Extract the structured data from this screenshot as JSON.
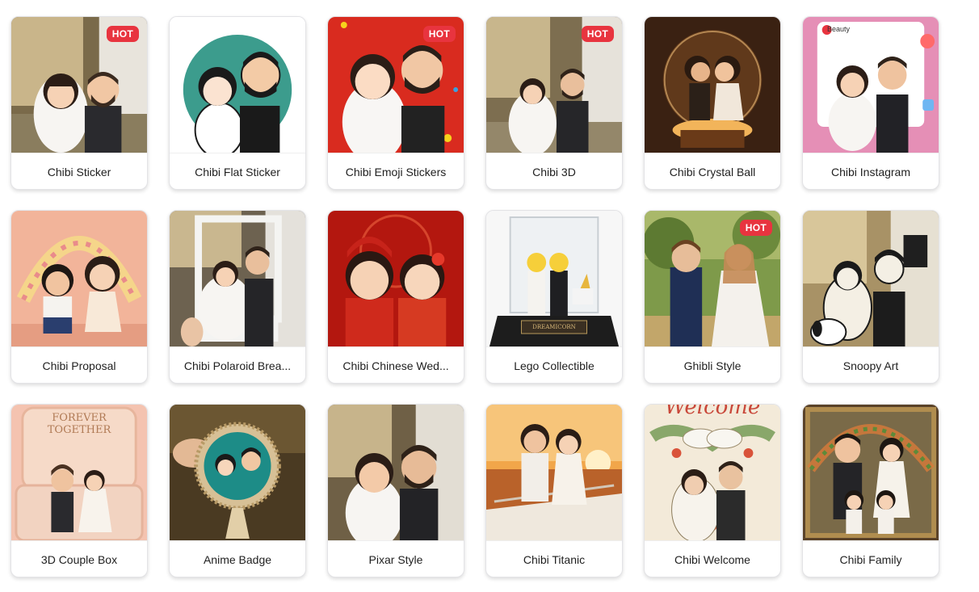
{
  "styles": [
    {
      "label": "Chibi Sticker",
      "hot": true,
      "icon": "chibi-sticker-image"
    },
    {
      "label": "Chibi Flat Sticker",
      "hot": false,
      "icon": "chibi-flat-sticker-image"
    },
    {
      "label": "Chibi Emoji Stickers",
      "hot": true,
      "icon": "chibi-emoji-stickers-image"
    },
    {
      "label": "Chibi 3D",
      "hot": true,
      "icon": "chibi-3d-image"
    },
    {
      "label": "Chibi Crystal Ball",
      "hot": false,
      "icon": "chibi-crystal-ball-image"
    },
    {
      "label": "Chibi Instagram",
      "hot": false,
      "icon": "chibi-instagram-image"
    },
    {
      "label": "Chibi Proposal",
      "hot": false,
      "icon": "chibi-proposal-image"
    },
    {
      "label": "Chibi Polaroid Brea...",
      "hot": false,
      "icon": "chibi-polaroid-image"
    },
    {
      "label": "Chibi Chinese Wed...",
      "hot": false,
      "icon": "chibi-chinese-wedding-image"
    },
    {
      "label": "Lego Collectible",
      "hot": false,
      "icon": "lego-collectible-image"
    },
    {
      "label": "Ghibli Style",
      "hot": true,
      "icon": "ghibli-style-image"
    },
    {
      "label": "Snoopy Art",
      "hot": false,
      "icon": "snoopy-art-image"
    },
    {
      "label": "3D Couple Box",
      "hot": false,
      "icon": "couple-box-image"
    },
    {
      "label": "Anime Badge",
      "hot": false,
      "icon": "anime-badge-image"
    },
    {
      "label": "Pixar Style",
      "hot": false,
      "icon": "pixar-style-image"
    },
    {
      "label": "Chibi Titanic",
      "hot": false,
      "icon": "chibi-titanic-image"
    },
    {
      "label": "Chibi Welcome",
      "hot": false,
      "icon": "chibi-welcome-image"
    },
    {
      "label": "Chibi Family",
      "hot": false,
      "icon": "chibi-family-image"
    }
  ],
  "badge_text": "HOT",
  "thumb_text": {
    "instagram_title": "Beauty",
    "lego_plaque": "DREAMICORN",
    "box_title_1": "FOREVER",
    "box_title_2": "TOGETHER",
    "welcome_title": "Welcome"
  },
  "colors": {
    "badge_bg": "#e8343f",
    "card_border": "#e3e3e6",
    "label_text": "#1f1f1f"
  }
}
